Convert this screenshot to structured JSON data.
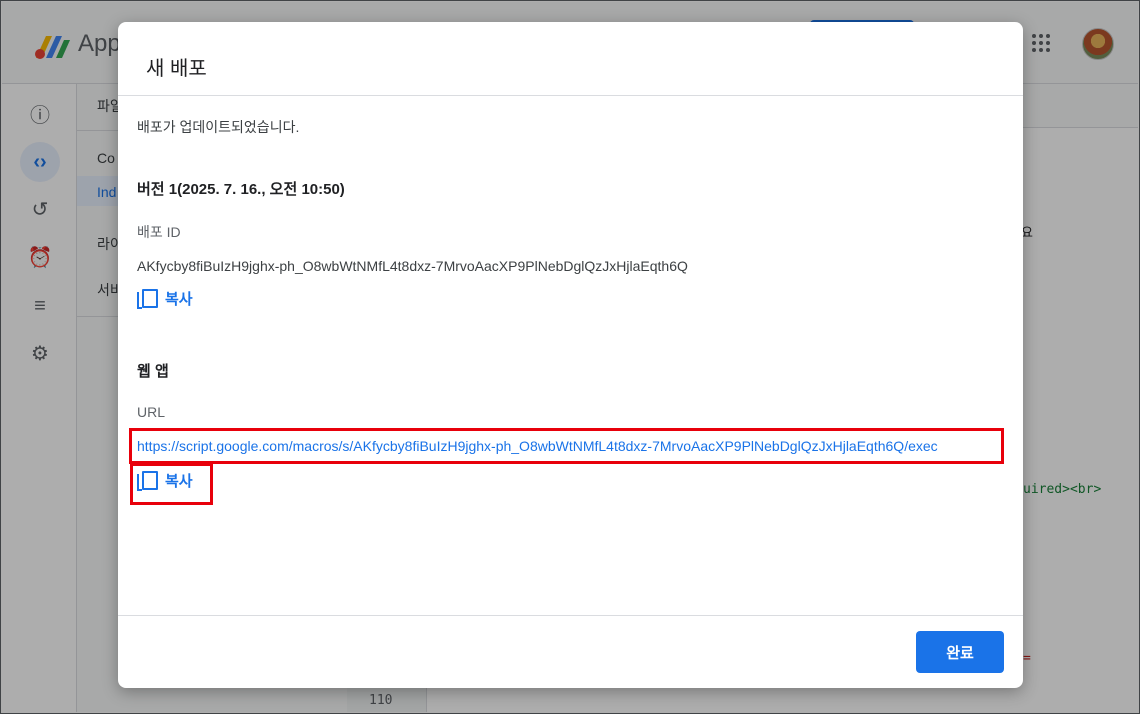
{
  "app": {
    "title_fragment": "App",
    "filepanel": {
      "heading_fragment": "파일",
      "items": [
        "Co",
        "Ind",
        "라이",
        "서비"
      ]
    },
    "editor": {
      "fragment_right_1": "요",
      "fragment_code": "uired><br>",
      "fragment_eq": "=",
      "line_number": "110"
    }
  },
  "dialog": {
    "title": "새 배포",
    "message": "배포가 업데이트되었습니다.",
    "version": "버전 1(2025. 7. 16., 오전 10:50)",
    "deployment_id_label": "배포 ID",
    "deployment_id": "AKfycby8fiBuIzH9jghx-ph_O8wbWtNMfL4t8dxz-7MrvoAacXP9PlNebDglQzJxHjlaEqth6Q",
    "copy_label": "복사",
    "webapp_heading": "웹 앱",
    "url_label": "URL",
    "url": "https://script.google.com/macros/s/AKfycby8fiBuIzH9jghx-ph_O8wbWtNMfL4t8dxz-7MrvoAacXP9PlNebDglQzJxHjlaEqth6Q/exec",
    "done_label": "완료"
  },
  "colors": {
    "accent": "#1a73e8",
    "highlight": "#e8000b"
  }
}
